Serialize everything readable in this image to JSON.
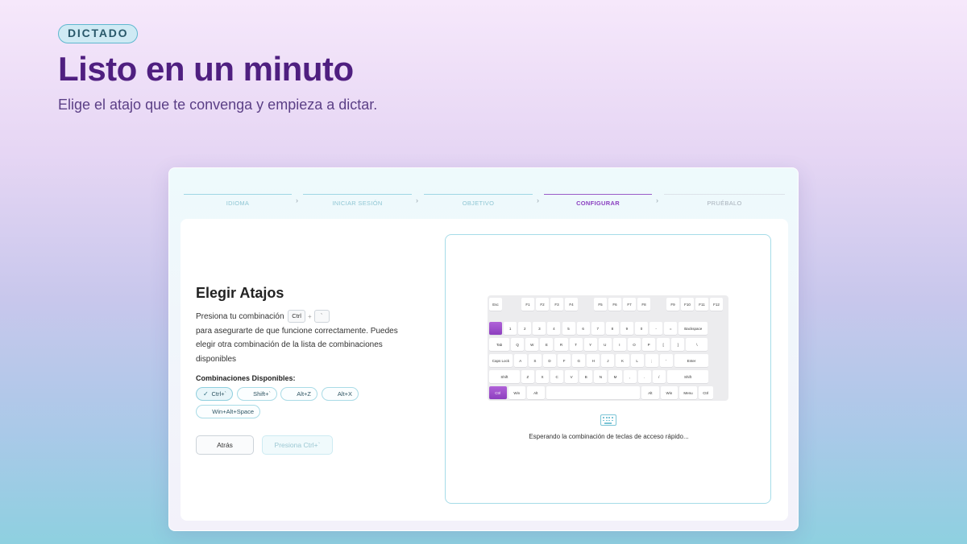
{
  "hero": {
    "badge": "DICTADO",
    "title": "Listo en un minuto",
    "subtitle": "Elige el atajo que te convenga y empieza a dictar."
  },
  "steps": [
    {
      "label": "IDIOMA",
      "state": "done"
    },
    {
      "label": "INICIAR SESIÓN",
      "state": "done"
    },
    {
      "label": "OBJETIVO",
      "state": "done"
    },
    {
      "label": "CONFIGURAR",
      "state": "active"
    },
    {
      "label": "PRUÉBALO",
      "state": "future"
    }
  ],
  "setup": {
    "title": "Elegir Atajos",
    "intro": "Presiona tu combinación",
    "key1": "Ctrl",
    "plus": "+",
    "key2": "`",
    "body": "para asegurarte de que funcione correctamente. Puedes elegir otra combinación de la lista de combinaciones disponibles",
    "available_label": "Combinaciones Disponibles:",
    "combos": [
      {
        "label": "Ctrl+`",
        "selected": true
      },
      {
        "label": "Shift+`",
        "selected": false
      },
      {
        "label": "Alt+Z",
        "selected": false
      },
      {
        "label": "Alt+X",
        "selected": false
      },
      {
        "label": "Win+Alt+Space",
        "selected": false
      }
    ],
    "check_glyph": "✓",
    "back_label": "Atrás",
    "next_label": "Presiona Ctrl+`"
  },
  "keyboard": {
    "row_fn": [
      "Esc",
      "F1",
      "F2",
      "F3",
      "F4",
      "F5",
      "F6",
      "F7",
      "F8",
      "F9",
      "F10",
      "F11",
      "F12"
    ],
    "row_num": [
      "`",
      "1",
      "2",
      "3",
      "4",
      "5",
      "6",
      "7",
      "8",
      "9",
      "0",
      "-",
      "=",
      "Backspace"
    ],
    "row_tab": [
      "Tab",
      "Q",
      "W",
      "E",
      "R",
      "T",
      "Y",
      "U",
      "I",
      "O",
      "P",
      "[",
      "]",
      "\\"
    ],
    "row_caps": [
      "Caps Lock",
      "A",
      "S",
      "D",
      "F",
      "G",
      "H",
      "J",
      "K",
      "L",
      ";",
      "'",
      "Enter"
    ],
    "row_shift": [
      "Shift",
      "Z",
      "X",
      "C",
      "V",
      "B",
      "N",
      "M",
      ",",
      ".",
      "/",
      "Shift"
    ],
    "row_bottom": [
      "Ctrl",
      "Win",
      "Alt",
      "",
      "Alt",
      "Win",
      "Menu",
      "Ctrl"
    ],
    "highlighted": [
      "`",
      "Ctrl"
    ],
    "status": "Esperando la combinación de teclas de acceso rápido..."
  }
}
